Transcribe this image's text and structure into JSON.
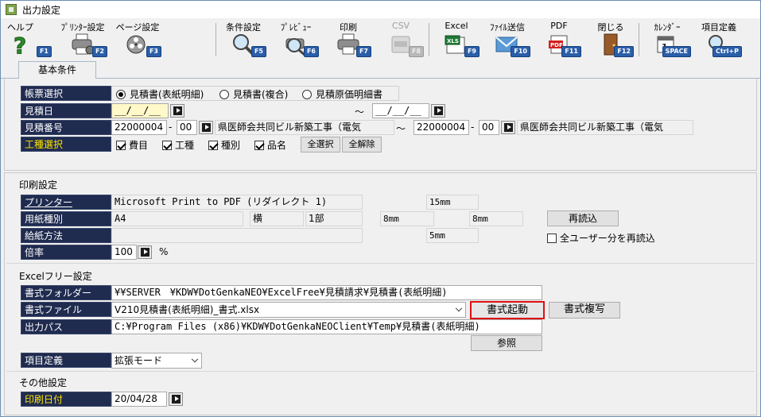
{
  "window": {
    "title": "出力設定"
  },
  "toolbar": [
    {
      "label": "ヘルプ",
      "key": "F1",
      "icon": "help-icon"
    },
    {
      "label": "ﾌﾟﾘﾝﾀｰ設定",
      "key": "F2",
      "icon": "printer-settings-icon"
    },
    {
      "label": "ページ設定",
      "key": "F3",
      "icon": "film-reel-icon"
    },
    {
      "label": "条件設定",
      "key": "F5",
      "icon": "magnifier-icon"
    },
    {
      "label": "ﾌﾟﾚﾋﾞｭｰ",
      "key": "F6",
      "icon": "preview-icon"
    },
    {
      "label": "印刷",
      "key": "F7",
      "icon": "printer-icon"
    },
    {
      "label": "CSV",
      "key": "F8",
      "icon": "csv-icon"
    },
    {
      "label": "Excel",
      "key": "F9",
      "icon": "excel-icon"
    },
    {
      "label": "ﾌｧｲﾙ送信",
      "key": "F10",
      "icon": "mail-icon"
    },
    {
      "label": "PDF",
      "key": "F11",
      "icon": "pdf-icon"
    },
    {
      "label": "閉じる",
      "key": "F12",
      "icon": "door-icon"
    },
    {
      "label": "ｶﾚﾝﾀﾞｰ",
      "key": "SPACE",
      "icon": "calendar-icon"
    },
    {
      "label": "項目定義",
      "key": "Ctrl+P",
      "icon": "field-definition-icon"
    }
  ],
  "tabs": {
    "basic": "基本条件"
  },
  "basic": {
    "form_select_label": "帳票選択",
    "form_options": [
      "見積書(表紙明細)",
      "見積書(複合)",
      "見積原価明細書"
    ],
    "date_label": "見積日",
    "date_from": "__/__/__",
    "date_to": "__/__/__",
    "tilde": "～",
    "number_label": "見積番号",
    "number_from": "22000004",
    "number_from_branch": "00",
    "number_from_name": "県医師会共同ビル新築工事（電気",
    "number_to": "22000004",
    "number_to_branch": "00",
    "number_to_name": "県医師会共同ビル新築工事（電気",
    "dash": "-",
    "trade_label": "工種選択",
    "trade_options": [
      "費目",
      "工種",
      "種別",
      "品名"
    ],
    "select_all": "全選択",
    "clear_all": "全解除"
  },
  "print": {
    "title": "印刷設定",
    "printer_label": "プリンター",
    "printer_value": "Microsoft Print to PDF (リダイレクト 1)",
    "paper_label": "用紙種別",
    "paper_value": "A4",
    "orientation": "横",
    "copies": "1部",
    "feed_label": "給紙方法",
    "scale_label": "倍率",
    "scale_value": "100",
    "percent": "%",
    "margin_top": "15mm",
    "margin_left": "8mm",
    "margin_right": "8mm",
    "margin_bottom": "5mm",
    "reload_button": "再読込",
    "reload_all_users": "全ユーザー分を再読込"
  },
  "excel": {
    "title": "Excelフリー設定",
    "folder_label": "書式フォルダー",
    "folder_value": "¥¥SERVER　¥KDW¥DotGenkaNEO¥ExcelFree¥見積請求¥見積書(表紙明細)",
    "file_label": "書式ファイル",
    "file_value": "V210見積書(表紙明細)_書式.xlsx",
    "launch_button": "書式起動",
    "copy_button": "書式複写",
    "output_label": "出力パス",
    "output_value": "C:¥Program Files (x86)¥KDW¥DotGenkaNEOClient¥Temp¥見積書(表紙明細)",
    "browse_button": "参照",
    "field_def_label": "項目定義",
    "field_def_value": "拡張モード"
  },
  "other": {
    "title": "その他設定",
    "print_date_label": "印刷日付",
    "print_date_value": "20/04/28"
  }
}
